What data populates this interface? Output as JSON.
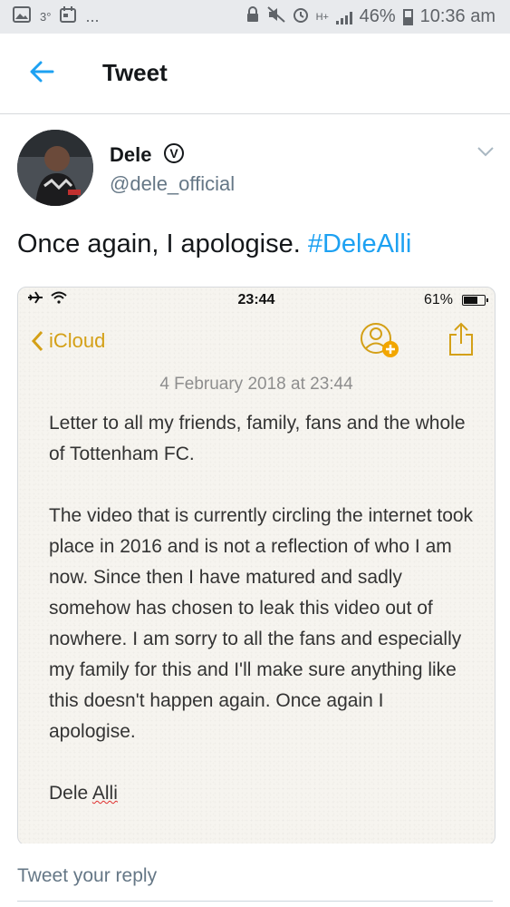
{
  "status_bar": {
    "left_indicator": "3°",
    "left_dots": "...",
    "network_label": "H+",
    "battery": "46%",
    "time": "10:36 am"
  },
  "header": {
    "title": "Tweet"
  },
  "tweet": {
    "author_name": "Dele",
    "verified_symbol": "V",
    "handle": "@dele_official",
    "text": "Once again, I apologise. ",
    "hashtag": "#DeleAlli"
  },
  "embedded_screenshot": {
    "ios_status": {
      "time": "23:44",
      "battery": "61%"
    },
    "back_label": "iCloud",
    "date": "4 February 2018 at 23:44",
    "paragraphs": [
      "Letter to all my friends, family, fans and the whole of Tottenham FC.",
      "The video that is currently circling the internet took place in 2016 and is not a reflection of who I am now. Since then I have matured and sadly somehow has chosen to leak this video out of nowhere. I am sorry to all the fans and especially my family for this and I'll make sure anything like this doesn't happen again. Once again I apologise."
    ],
    "signature_first": "Dele ",
    "signature_last": "Alli"
  },
  "reply": {
    "placeholder": "Tweet your reply"
  },
  "colors": {
    "twitter_blue": "#1da1f2",
    "icloud_gold": "#d4a017",
    "text_dark": "#14171a",
    "text_gray": "#657786"
  }
}
